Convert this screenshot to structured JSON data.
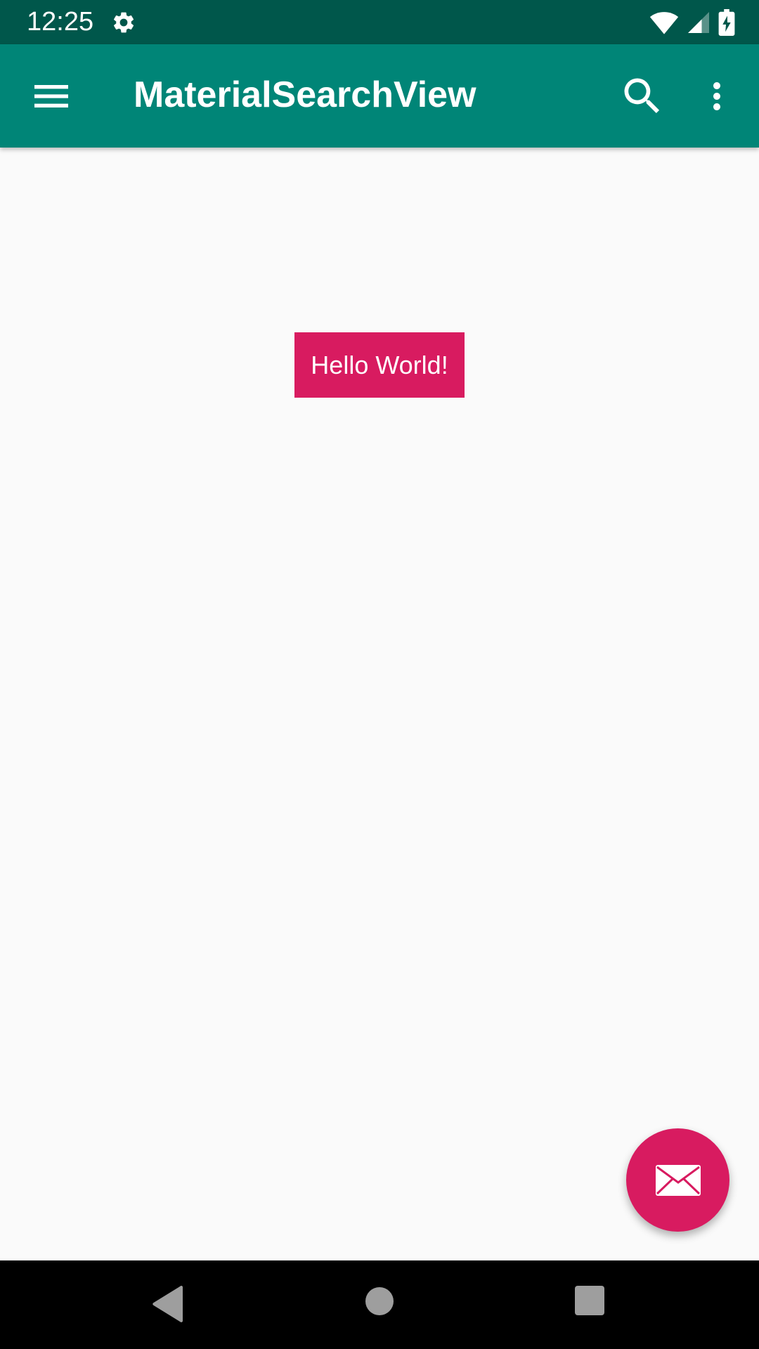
{
  "status_bar": {
    "time": "12:25",
    "icons": [
      "settings-icon",
      "wifi-icon",
      "signal-icon",
      "battery-charging-icon"
    ]
  },
  "app_bar": {
    "title": "MaterialSearchView",
    "icons": [
      "menu-icon",
      "search-icon",
      "more-vert-icon"
    ]
  },
  "content": {
    "hello_text": "Hello World!"
  },
  "fab": {
    "icon": "mail-icon"
  },
  "nav_bar": {
    "icons": [
      "back-icon",
      "home-icon",
      "recents-icon"
    ]
  },
  "colors": {
    "status_bar": "#00574B",
    "app_bar": "#008577",
    "accent": "#D81B60",
    "background": "#FAFAFA",
    "nav_bar": "#000000"
  }
}
